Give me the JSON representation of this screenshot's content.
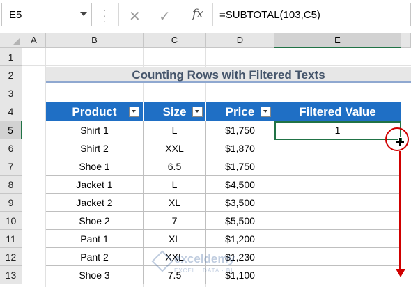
{
  "formula_bar": {
    "name_box": "E5",
    "cancel_icon": "✕",
    "enter_icon": "✓",
    "fx_label": "fx",
    "formula": "=SUBTOTAL(103,C5)"
  },
  "columns": [
    "A",
    "B",
    "C",
    "D",
    "E"
  ],
  "rows": [
    "1",
    "2",
    "3",
    "4",
    "5",
    "6",
    "7",
    "8",
    "9",
    "10",
    "11",
    "12",
    "13"
  ],
  "title": "Counting Rows with Filtered Texts",
  "table": {
    "headers": [
      "Product",
      "Size",
      "Price",
      "Filtered Value"
    ],
    "rows": [
      [
        "Shirt 1",
        "L",
        "$1,750",
        "1"
      ],
      [
        "Shirt 2",
        "XXL",
        "$1,870",
        ""
      ],
      [
        "Shoe 1",
        "6.5",
        "$1,750",
        ""
      ],
      [
        "Jacket 1",
        "L",
        "$4,500",
        ""
      ],
      [
        "Jacket 2",
        "XL",
        "$3,500",
        ""
      ],
      [
        "Shoe 2",
        "7",
        "$5,500",
        ""
      ],
      [
        "Pant 1",
        "XL",
        "$1,200",
        ""
      ],
      [
        "Pant 2",
        "XXL",
        "$1,230",
        ""
      ],
      [
        "Shoe 3",
        "7.5",
        "$1,100",
        ""
      ]
    ]
  },
  "watermark": {
    "name": "exceldemy",
    "tagline": "EXCEL · DATA · BI"
  },
  "colors": {
    "header_bg": "#1f6fc5",
    "selection": "#217346",
    "annotation": "#d00000"
  }
}
